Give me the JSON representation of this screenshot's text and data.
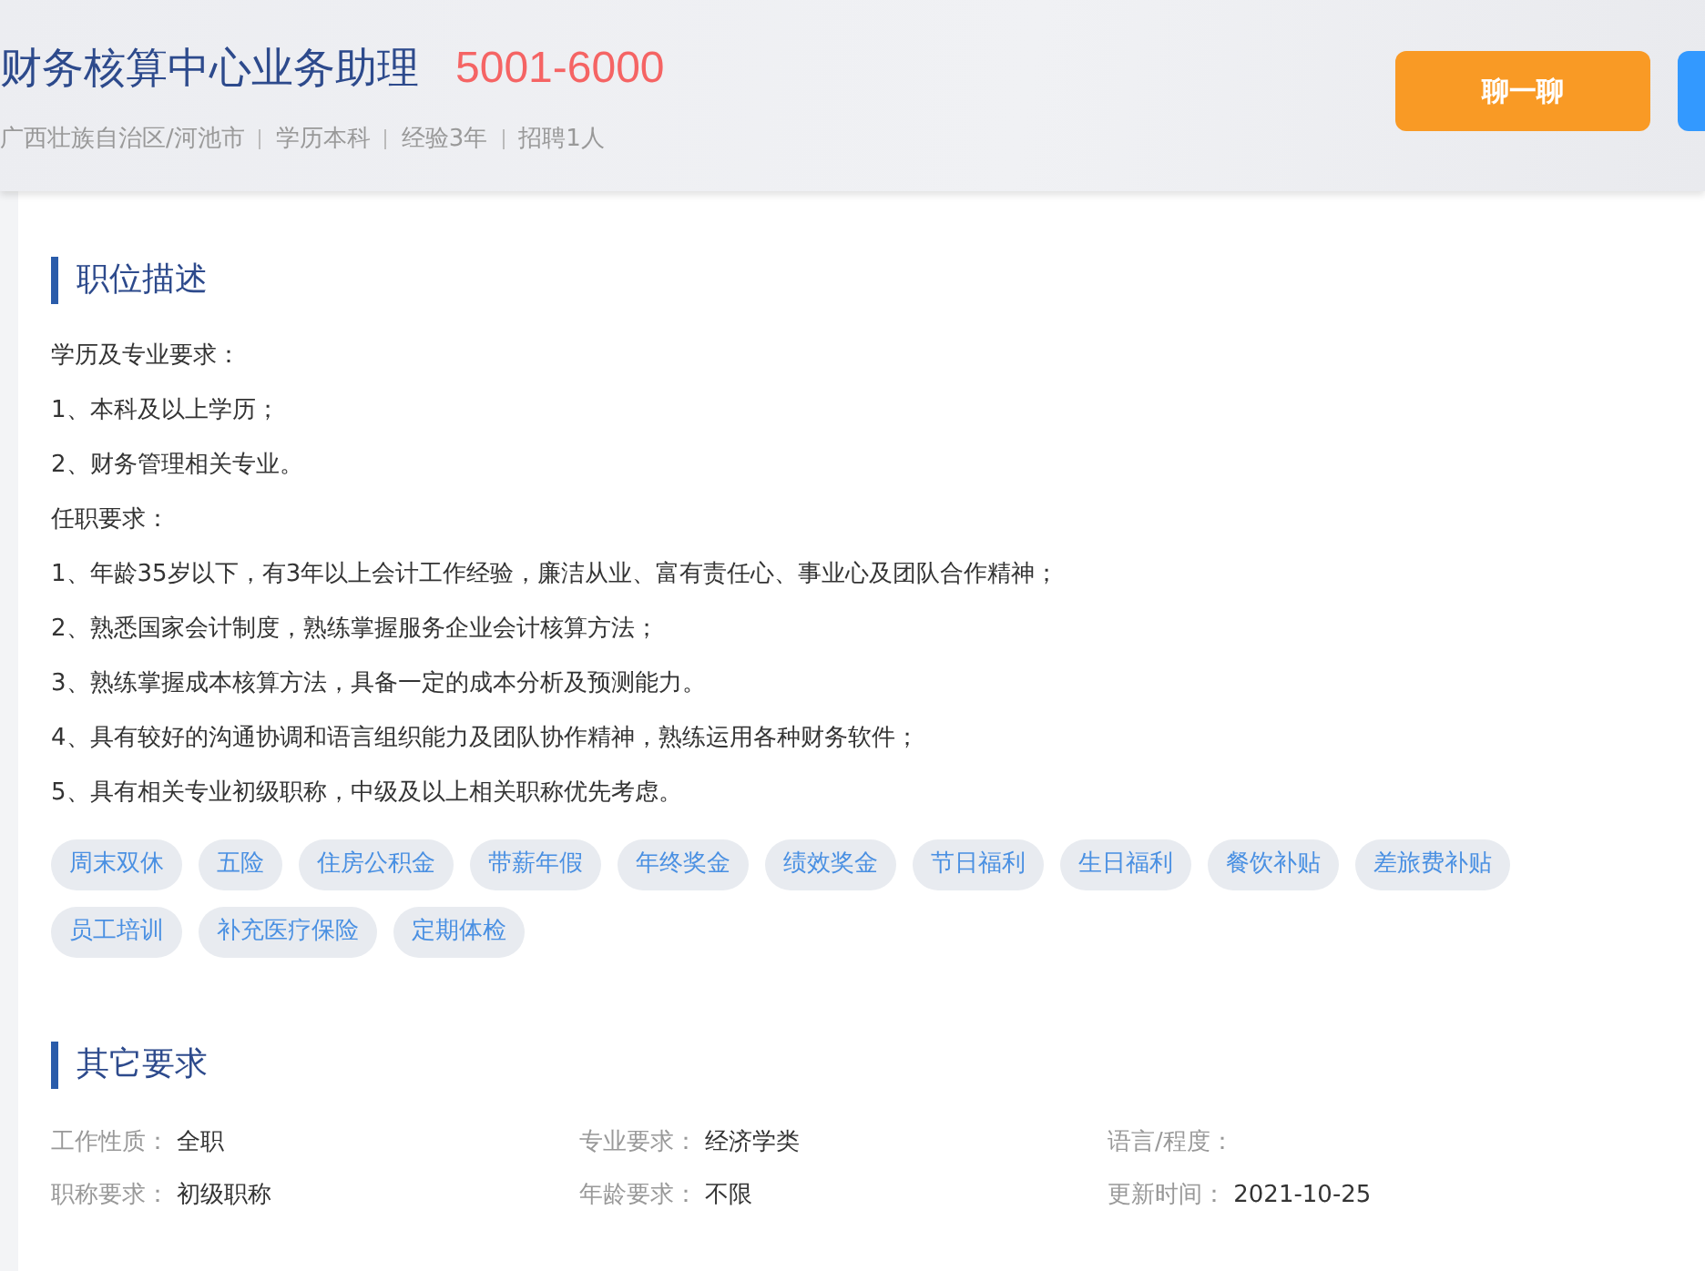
{
  "header": {
    "title": "财务核算中心业务助理",
    "salary": "5001-6000",
    "meta": [
      "广西壮族自治区/河池市",
      "学历本科",
      "经验3年",
      "招聘1人"
    ],
    "buttons": [
      {
        "label": "聊一聊",
        "kind": "orange"
      },
      {
        "kind": "blue"
      }
    ]
  },
  "description": {
    "heading": "职位描述",
    "lines": [
      "学历及专业要求：",
      "1、本科及以上学历；",
      "2、财务管理相关专业。",
      "任职要求：",
      "1、年龄35岁以下，有3年以上会计工作经验，廉洁从业、富有责任心、事业心及团队合作精神；",
      "2、熟悉国家会计制度，熟练掌握服务企业会计核算方法；",
      "3、熟练掌握成本核算方法，具备一定的成本分析及预测能力。",
      "4、具有较好的沟通协调和语言组织能力及团队协作精神，熟练运用各种财务软件；",
      "5、具有相关专业初级职称，中级及以上相关职称优先考虑。"
    ],
    "tags": [
      "周末双休",
      "五险",
      "住房公积金",
      "带薪年假",
      "年终奖金",
      "绩效奖金",
      "节日福利",
      "生日福利",
      "餐饮补贴",
      "差旅费补贴",
      "员工培训",
      "补充医疗保险",
      "定期体检"
    ]
  },
  "other": {
    "heading": "其它要求",
    "fields": [
      {
        "label": "工作性质：",
        "value": "全职"
      },
      {
        "label": "专业要求：",
        "value": "经济学类"
      },
      {
        "label": "语言/程度："
      },
      {
        "label": "职称要求：",
        "value": "初级职称"
      },
      {
        "label": "年龄要求：",
        "value": "不限"
      },
      {
        "label": "更新时间：",
        "value": "2021-10-25"
      }
    ]
  }
}
